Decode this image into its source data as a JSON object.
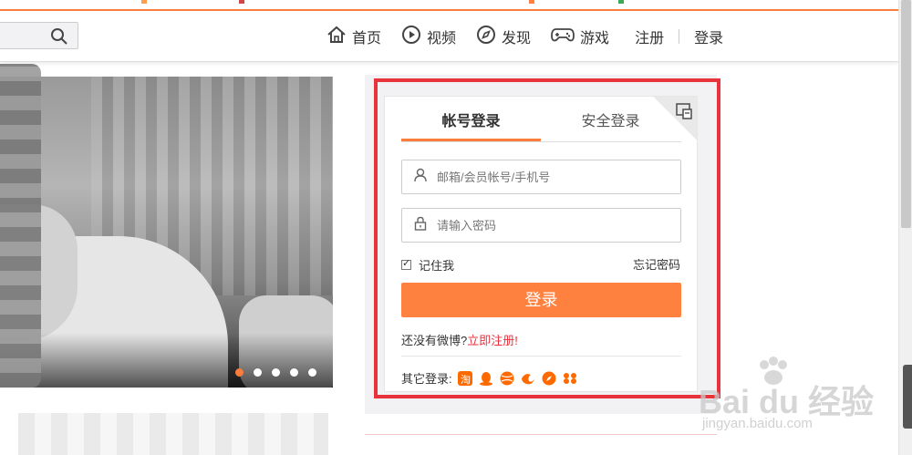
{
  "nav": {
    "items": [
      {
        "label": "首页",
        "icon": "home-icon"
      },
      {
        "label": "视频",
        "icon": "video-icon"
      },
      {
        "label": "发现",
        "icon": "compass-icon"
      },
      {
        "label": "游戏",
        "icon": "gamepad-icon"
      }
    ],
    "register": "注册",
    "login": "登录"
  },
  "login_card": {
    "tabs": [
      "帐号登录",
      "安全登录"
    ],
    "username_placeholder": "邮箱/会员帐号/手机号",
    "password_placeholder": "请输入密码",
    "remember": "记住我",
    "forgot": "忘记密码",
    "submit": "登录",
    "no_account": "还没有微博?",
    "register_now": "立即注册!",
    "other_login": "其它登录:"
  },
  "watermark": {
    "text": "Bai du 经验",
    "url": "jingyan.baidu.com"
  },
  "colors": {
    "accent": "#fa7d3c",
    "highlight_box": "#e8323c",
    "button": "#ff8140"
  }
}
